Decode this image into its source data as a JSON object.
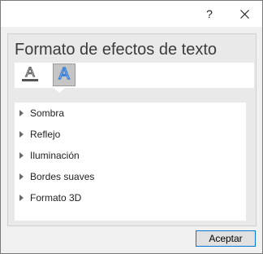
{
  "titlebar": {
    "help_label": "?",
    "close_icon": "close-icon"
  },
  "pane": {
    "title": "Formato de efectos de texto",
    "tabs": [
      {
        "icon": "text-fill-outline-icon",
        "selected": false
      },
      {
        "icon": "text-effects-icon",
        "selected": true
      }
    ],
    "items": [
      {
        "label": "Sombra",
        "icon": "expand-arrow-icon"
      },
      {
        "label": "Reflejo",
        "icon": "expand-arrow-icon"
      },
      {
        "label": "Iluminación",
        "icon": "expand-arrow-icon"
      },
      {
        "label": "Bordes suaves",
        "icon": "expand-arrow-icon"
      },
      {
        "label": "Formato 3D",
        "icon": "expand-arrow-icon"
      }
    ]
  },
  "footer": {
    "accept_label": "Aceptar"
  },
  "colors": {
    "window_bg": "#f0f0f0",
    "accent_blue": "#0078d7",
    "effects_icon_blue": "#3a7fd5"
  }
}
